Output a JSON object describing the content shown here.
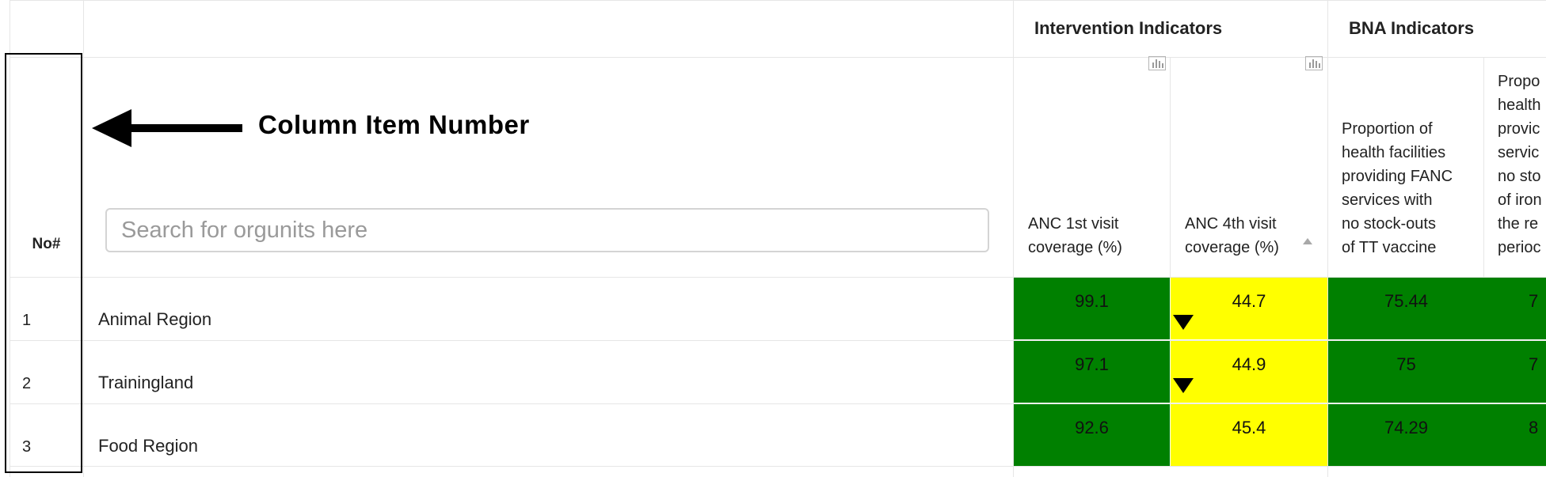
{
  "header": {
    "group_intervention": "Intervention Indicators",
    "group_bna": "BNA Indicators",
    "no_label": "No#"
  },
  "search": {
    "placeholder": "Search for orgunits here",
    "value": ""
  },
  "columns": [
    {
      "label_line1": "ANC 1st visit",
      "label_line2": "coverage (%)"
    },
    {
      "label_line1": "ANC 4th visit",
      "label_line2": "coverage (%)"
    },
    {
      "lines": [
        "Proportion of",
        "health facilities",
        "providing FANC",
        "services with",
        "no stock-outs",
        "of TT vaccine"
      ]
    },
    {
      "lines": [
        "Propo",
        "health",
        "provic",
        "servic",
        "no sto",
        "of iron",
        "the re",
        "perioc"
      ]
    }
  ],
  "rows": [
    {
      "no": "1",
      "name": "Animal Region",
      "values": [
        "99.1",
        "44.7",
        "75.44",
        "7"
      ]
    },
    {
      "no": "2",
      "name": "Trainingland",
      "values": [
        "97.1",
        "44.9",
        "75",
        "7"
      ]
    },
    {
      "no": "3",
      "name": "Food Region",
      "values": [
        "92.6",
        "45.4",
        "74.29",
        "8"
      ]
    }
  ],
  "annotation": {
    "label": "Column Item Number"
  },
  "colors": {
    "green": "#008000",
    "yellow": "#ffff00",
    "border": "#e6e6e6"
  },
  "icons": [
    "chart-icon",
    "sort-asc-icon",
    "down-triangle-icon",
    "left-arrow-icon"
  ]
}
